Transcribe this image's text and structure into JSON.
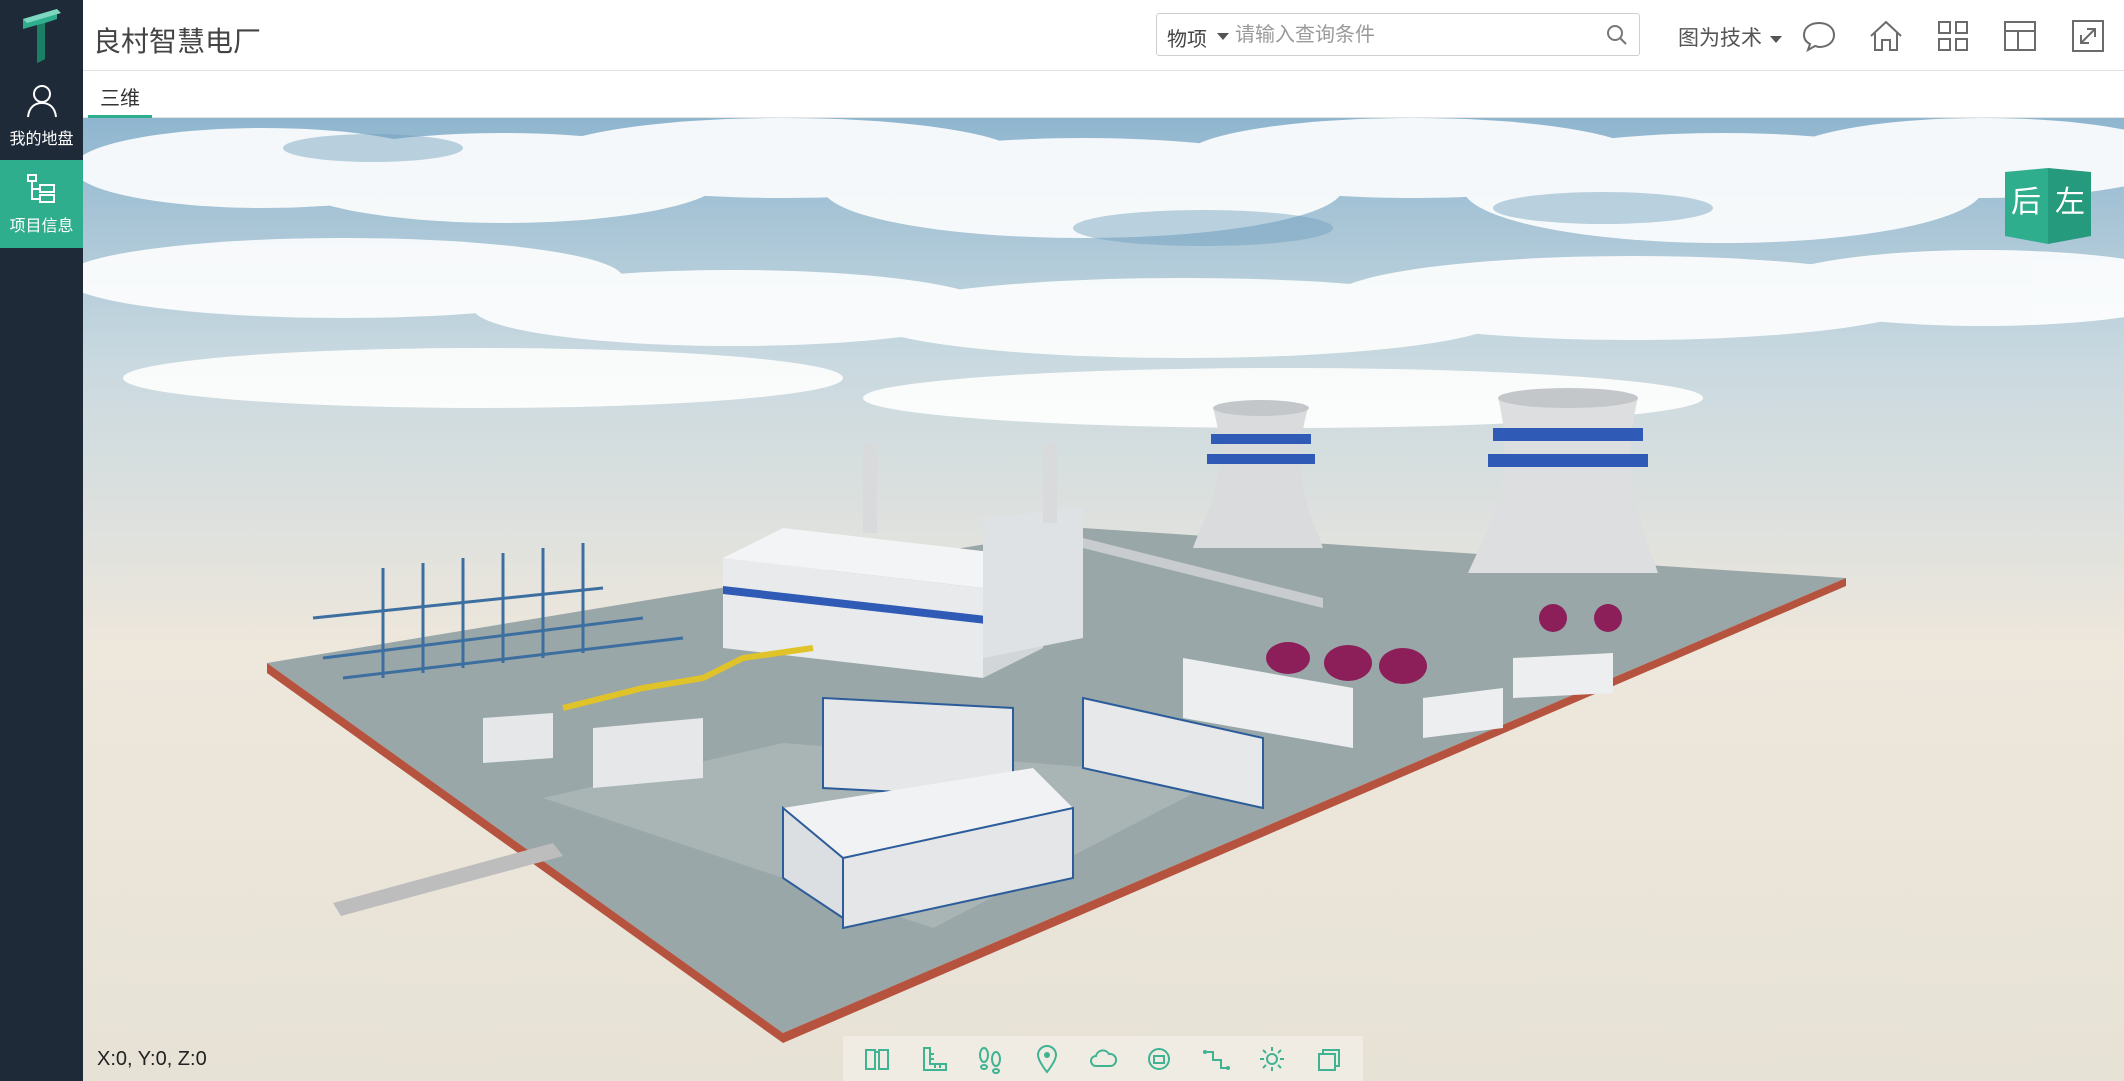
{
  "app": {
    "title": "良村智慧电厂"
  },
  "sidebar": {
    "items": [
      {
        "label": "我的地盘",
        "icon": "user-icon",
        "active": false
      },
      {
        "label": "项目信息",
        "icon": "tree-structure-icon",
        "active": true
      }
    ]
  },
  "search": {
    "category": "物项",
    "placeholder": "请输入查询条件",
    "value": ""
  },
  "header": {
    "tech_label": "图为技术",
    "icons": [
      "chat-icon",
      "home-icon",
      "grid-icon",
      "layout-icon",
      "fullscreen-icon"
    ]
  },
  "tabs": [
    {
      "label": "三维",
      "active": true
    }
  ],
  "viewport": {
    "coords": "X:0, Y:0, Z:0",
    "compass": {
      "left": "后",
      "right": "左"
    },
    "toolbar": [
      "book-icon",
      "ruler-icon",
      "footprints-icon",
      "location-pin-icon",
      "cloud-icon",
      "camera-rotate-icon",
      "path-icon",
      "gear-icon",
      "layers-icon"
    ]
  },
  "colors": {
    "accent": "#2fae8e",
    "sidebar_bg": "#1e2a38"
  }
}
